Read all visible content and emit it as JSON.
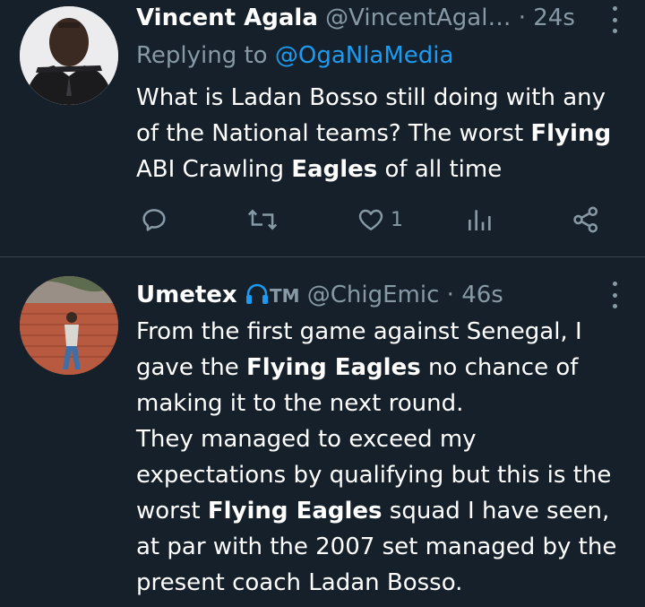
{
  "tweets": [
    {
      "name": "Vincent Agala",
      "handle": "@VincentAgal…",
      "dot": "·",
      "time": "24s",
      "replying_prefix": "Replying to ",
      "replying_to": "@OgaNlaMedia",
      "text": [
        {
          "t": "What is Ladan Bosso still doing with any of the National teams? The worst ",
          "b": false
        },
        {
          "t": "Flying",
          "b": true
        },
        {
          "t": " ABI Crawling ",
          "b": false
        },
        {
          "t": "Eagles",
          "b": true
        },
        {
          "t": " of all time",
          "b": false
        }
      ],
      "actions": {
        "reply_count": "",
        "retweet_count": "",
        "like_count": "1",
        "views_count": ""
      }
    },
    {
      "name": "Umetex",
      "tm": "TM",
      "handle": "@ChigEmic",
      "dot": "·",
      "time": "46s",
      "text": [
        {
          "t": "From the first game against Senegal, I gave the ",
          "b": false
        },
        {
          "t": "Flying Eagles",
          "b": true
        },
        {
          "t": " no chance of making it to the next round.",
          "b": false
        },
        {
          "t": "\n",
          "b": false
        },
        {
          "t": "They managed to exceed my expectations by qualifying but this is the worst ",
          "b": false
        },
        {
          "t": "Flying Eagles",
          "b": true
        },
        {
          "t": " squad I have seen, at par with the 2007 set managed by the present coach Ladan Bosso.",
          "b": false
        }
      ]
    }
  ],
  "icons": {
    "reply": "reply-icon",
    "retweet": "retweet-icon",
    "like": "heart-icon",
    "views": "analytics-icon",
    "share": "share-icon",
    "more": "more-icon",
    "headphones": "headphones-icon"
  },
  "colors": {
    "background": "#15202b",
    "text": "#ffffff",
    "muted": "#8899a6",
    "link": "#1d9bf0",
    "divider": "#38444d"
  }
}
